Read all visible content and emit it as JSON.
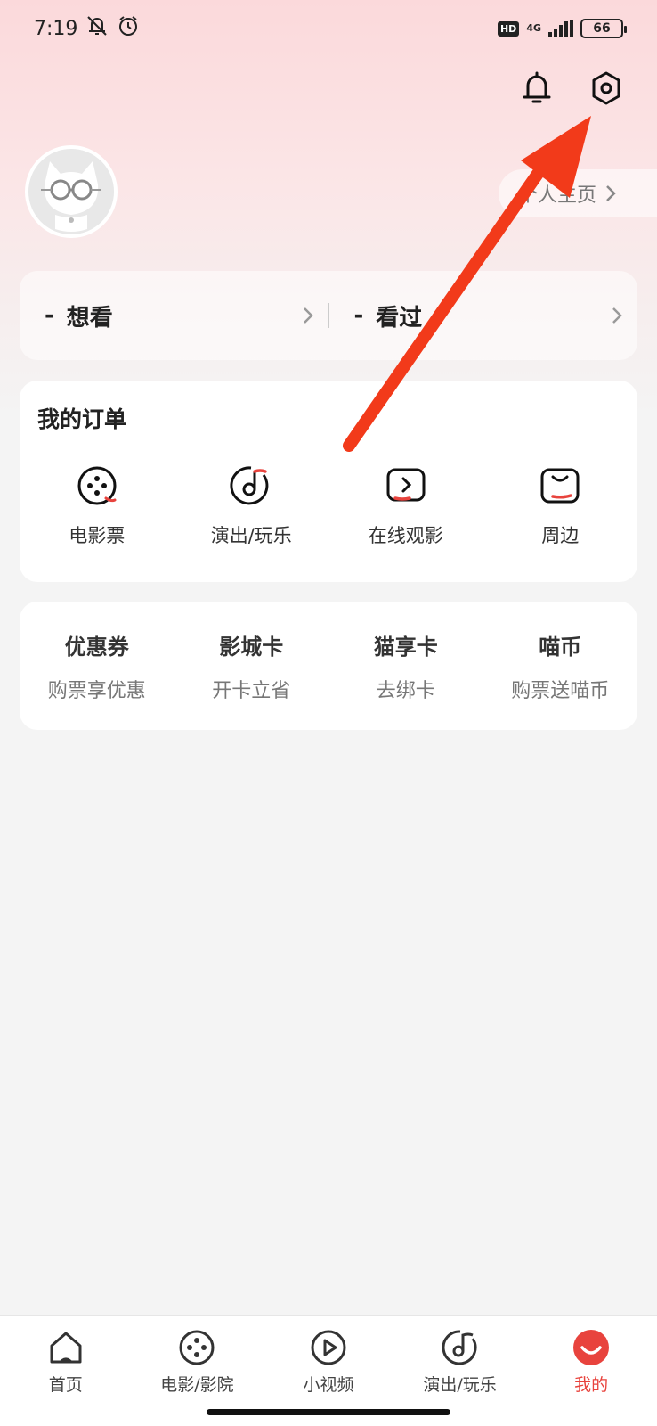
{
  "status_bar": {
    "time": "7:19",
    "hd": "HD",
    "network": "4G",
    "battery": "66"
  },
  "header": {
    "icons": [
      "bell-icon",
      "settings-icon"
    ]
  },
  "profile": {
    "link_label": "个人主页"
  },
  "watchlist": {
    "want": {
      "count": "-",
      "label": "想看"
    },
    "watched": {
      "count": "-",
      "label": "看过"
    }
  },
  "orders": {
    "title": "我的订单",
    "items": [
      {
        "label": "电影票",
        "icon": "film-reel-icon"
      },
      {
        "label": "演出/玩乐",
        "icon": "music-disc-icon"
      },
      {
        "label": "在线观影",
        "icon": "online-play-icon"
      },
      {
        "label": "周边",
        "icon": "merch-bag-icon"
      }
    ]
  },
  "benefits": [
    {
      "title": "优惠券",
      "subtitle": "购票享优惠"
    },
    {
      "title": "影城卡",
      "subtitle": "开卡立省"
    },
    {
      "title": "猫享卡",
      "subtitle": "去绑卡"
    },
    {
      "title": "喵币",
      "subtitle": "购票送喵币"
    }
  ],
  "tab_bar": {
    "active": "我的",
    "items": [
      {
        "label": "首页",
        "icon": "home-icon"
      },
      {
        "label": "电影/影院",
        "icon": "film-reel-icon"
      },
      {
        "label": "小视频",
        "icon": "play-circle-icon"
      },
      {
        "label": "演出/玩乐",
        "icon": "music-disc-icon"
      },
      {
        "label": "我的",
        "icon": "profile-dot-icon"
      }
    ]
  },
  "colors": {
    "accent": "#e8433d",
    "arrow": "#f23a1a",
    "header_gradient_top": "#fbd9db"
  }
}
